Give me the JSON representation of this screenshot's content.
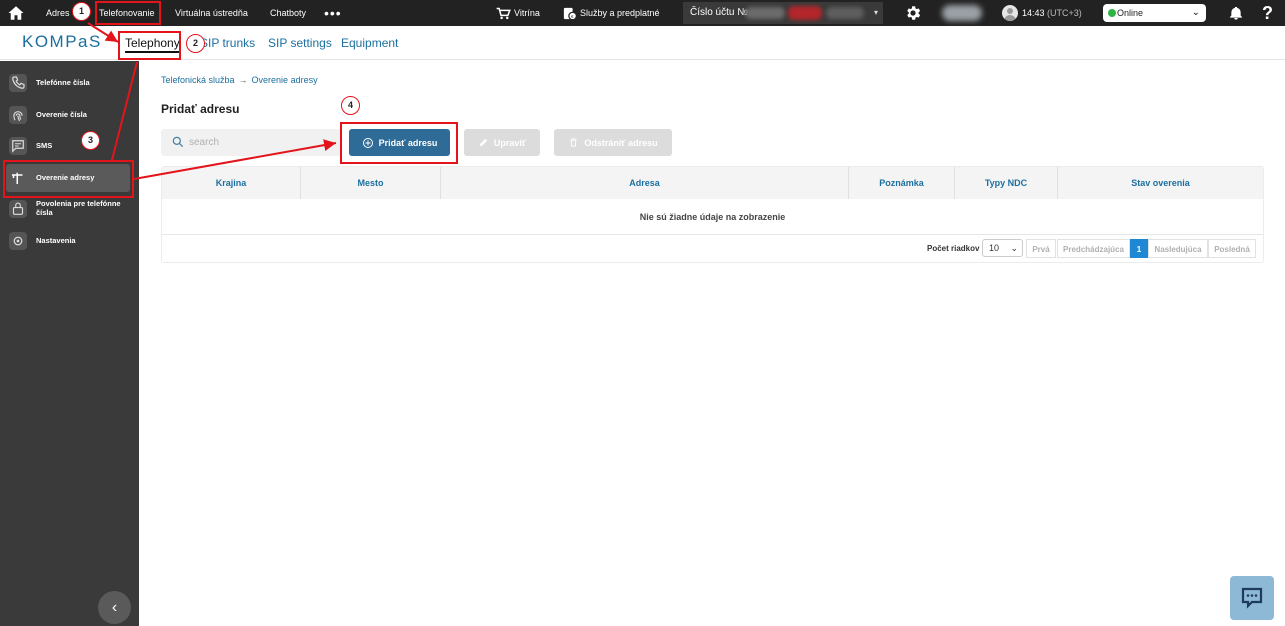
{
  "topbar": {
    "items": [
      "Adres",
      "Telefonovanie",
      "Virtuálna ústredňa",
      "Chatboty"
    ],
    "more": "•••",
    "vitrina": "Vitrína",
    "services": "Služby a predplatné",
    "account_label": "Číslo účtu №",
    "time": "14:43",
    "timezone": "(UTC+3)",
    "status": "Online",
    "help": "?"
  },
  "subnav": {
    "logo": "KOMPaS",
    "tabs": [
      "Telephony",
      "SIP trunks",
      "SIP settings",
      "Equipment"
    ]
  },
  "sidebar": {
    "items": [
      {
        "label": "Telefónne čísla",
        "icon": "phone-icon"
      },
      {
        "label": "Overenie čísla",
        "icon": "fingerprint-icon"
      },
      {
        "label": "SMS",
        "icon": "message-icon"
      },
      {
        "label": "Overenie adresy",
        "icon": "signpost-icon"
      },
      {
        "label": "Povolenia pre telefónne čísla",
        "icon": "lock-icon"
      },
      {
        "label": "Nastavenia",
        "icon": "gear-icon"
      }
    ],
    "collapse": "‹"
  },
  "breadcrumb": {
    "parent": "Telefonická služba",
    "separator": "→",
    "current": "Overenie adresy"
  },
  "page": {
    "title": "Pridať adresu",
    "search_placeholder": "search",
    "add_button": "Pridať adresu",
    "edit_button": "Upraviť",
    "delete_button": "Odstrániť adresu"
  },
  "table": {
    "columns": [
      "Krajina",
      "Mesto",
      "Adresa",
      "Poznámka",
      "Typy NDC",
      "Stav overenia"
    ],
    "empty_message": "Nie sú žiadne údaje na zobrazenie"
  },
  "pagination": {
    "rows_label": "Počet riadkov",
    "rows_value": "10",
    "first": "Prvá",
    "previous": "Predchádzajúca",
    "current_page": "1",
    "next": "Nasledujúca",
    "last": "Posledná"
  },
  "annotations": [
    "1",
    "2",
    "3",
    "4"
  ],
  "colors": {
    "accent": "#1b6fa0",
    "primary_button": "#2e6b96",
    "annotation": "#e3151b",
    "status_online": "#2fb344",
    "sidebar_bg": "#3a3a3a",
    "topbar_bg": "#222222"
  }
}
